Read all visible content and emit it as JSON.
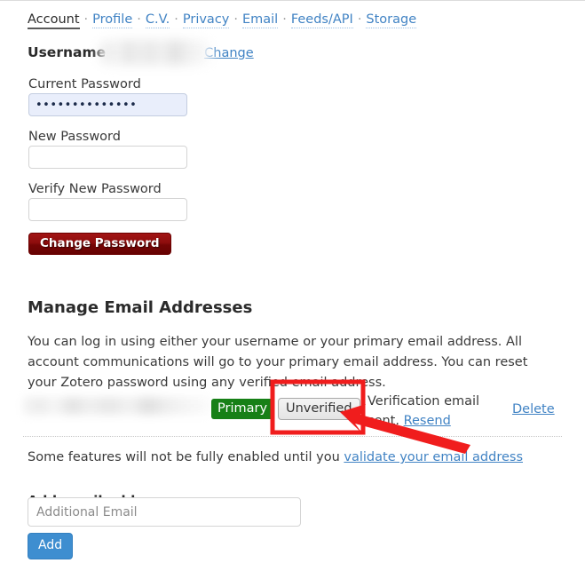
{
  "nav": {
    "separator": "·",
    "items": [
      {
        "label": "Account",
        "current": true
      },
      {
        "label": "Profile",
        "current": false
      },
      {
        "label": "C.V.",
        "current": false
      },
      {
        "label": "Privacy",
        "current": false
      },
      {
        "label": "Email",
        "current": false
      },
      {
        "label": "Feeds/API",
        "current": false
      },
      {
        "label": "Storage",
        "current": false
      }
    ]
  },
  "account": {
    "username_label": "Username",
    "username_value": "",
    "change_link": "Change"
  },
  "password_form": {
    "current_label": "Current Password",
    "current_value": "••••••••••••••",
    "new_label": "New Password",
    "new_value": "",
    "verify_label": "Verify New Password",
    "verify_value": "",
    "submit_label": "Change Password"
  },
  "email_section": {
    "title": "Manage Email Addresses",
    "description": "You can log in using either your username or your primary email address. All account communications will go to your primary email address. You can reset your Zotero password using any verified email address.",
    "row": {
      "address": "",
      "primary_badge": "Primary",
      "unverified_button": "Unverified",
      "verification_text": "Verification email sent.",
      "resend_link": "Resend",
      "delete_link": "Delete"
    },
    "validate_notice": {
      "text": "Some features will not be fully enabled until you",
      "link": "validate your email address"
    },
    "add": {
      "title": "Add email address",
      "placeholder": "Additional Email",
      "value": "",
      "button_label": "Add"
    }
  },
  "annotations": {
    "highlight_color": "#f01d1d",
    "highlight_target": "Unverified"
  },
  "colors": {
    "link": "#4183c4",
    "primary_badge_bg": "#178017",
    "change_password_bg": "#8d0d0d",
    "add_button_bg": "#3e8ed0",
    "annotation_red": "#f01d1d"
  }
}
